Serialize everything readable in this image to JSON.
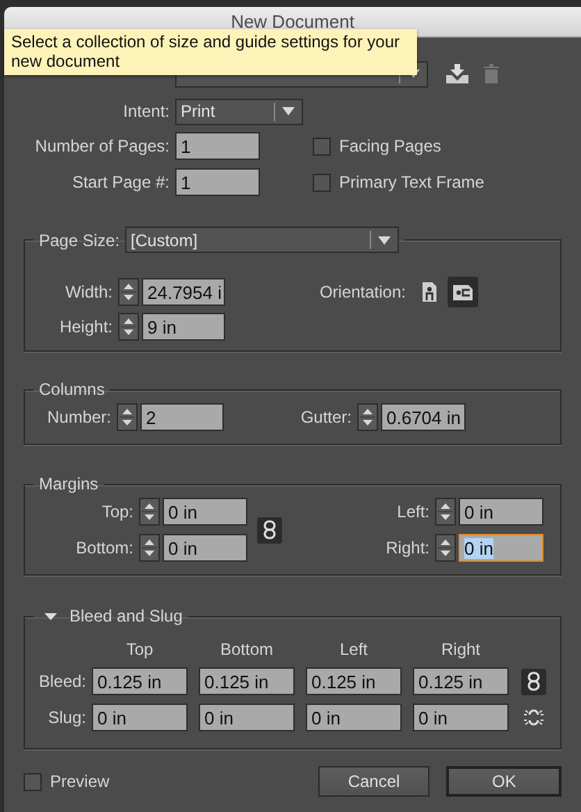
{
  "window": {
    "title": "New Document"
  },
  "tooltip": "Select a collection of size and guide settings for your new document",
  "intent": {
    "label": "Intent:",
    "value": "Print"
  },
  "pages": [
    {
      "label": "Number of Pages:",
      "value": "1",
      "option": {
        "label": "Facing Pages",
        "checked": false
      }
    },
    {
      "label": "Start Page #:",
      "value": "1",
      "option": {
        "label": "Primary Text Frame",
        "checked": false
      }
    }
  ],
  "page_size": {
    "label": "Page Size:",
    "value": "[Custom]",
    "width": {
      "label": "Width:",
      "value": "24.7954 i"
    },
    "height": {
      "label": "Height:",
      "value": "9 in"
    },
    "orientation": {
      "label": "Orientation:",
      "options": [
        {
          "kind": "portrait",
          "selected": false
        },
        {
          "kind": "landscape",
          "selected": true
        }
      ]
    }
  },
  "columns": {
    "title": "Columns",
    "number": {
      "label": "Number:",
      "value": "2"
    },
    "gutter": {
      "label": "Gutter:",
      "value": "0.6704 in"
    }
  },
  "margins": {
    "title": "Margins",
    "linked": true,
    "fields": [
      {
        "label": "Top:",
        "value": "0 in",
        "focused": false
      },
      {
        "label": "Left:",
        "value": "0 in",
        "focused": false
      },
      {
        "label": "Bottom:",
        "value": "0 in",
        "focused": false
      },
      {
        "label": "Right:",
        "value": "0 in",
        "focused": true
      }
    ]
  },
  "bleed_slug": {
    "title": "Bleed and Slug",
    "expanded": true,
    "headers": [
      "Top",
      "Bottom",
      "Left",
      "Right"
    ],
    "rows": [
      {
        "label": "Bleed:",
        "values": [
          "0.125 in",
          "0.125 in",
          "0.125 in",
          "0.125 in"
        ],
        "linked": true
      },
      {
        "label": "Slug:",
        "values": [
          "0 in",
          "0 in",
          "0 in",
          "0 in"
        ],
        "linked": false
      }
    ]
  },
  "preview": {
    "label": "Preview",
    "checked": false
  },
  "buttons": [
    {
      "label": "Cancel",
      "default": false
    },
    {
      "label": "OK",
      "default": true
    }
  ]
}
